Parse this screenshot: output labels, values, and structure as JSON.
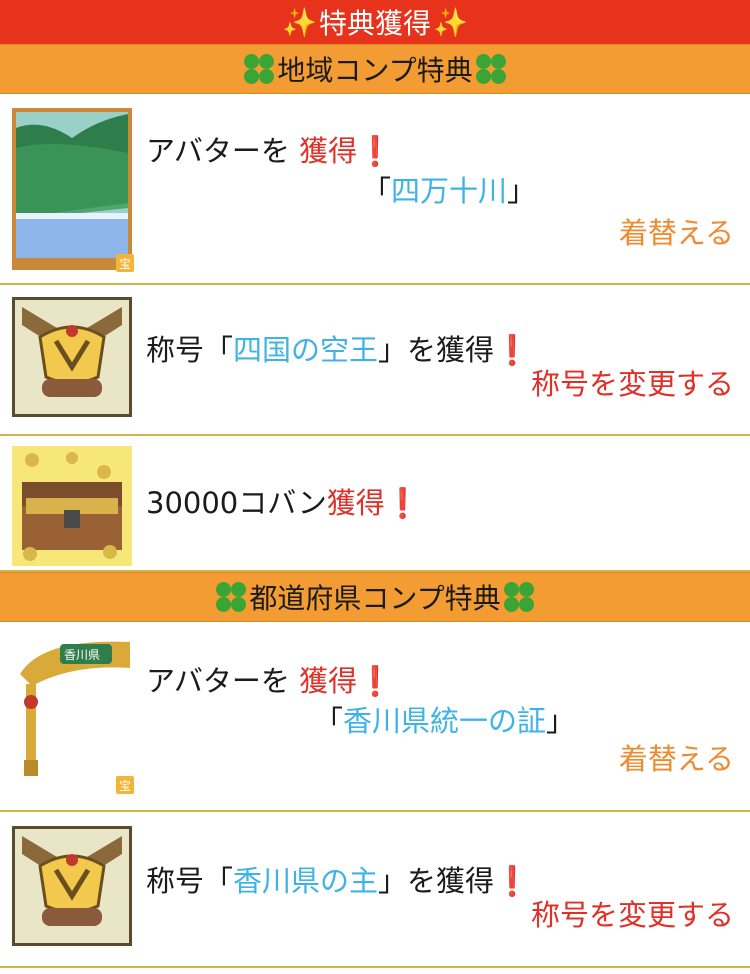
{
  "header": {
    "title": "特典獲得",
    "sparkle": "✨"
  },
  "sections": [
    {
      "title": "地域コンプ特典",
      "rows": [
        {
          "prefix": "アバターを",
          "highlight": "獲得",
          "excl": "❗",
          "quote_open": "「",
          "item_name": "四万十川",
          "quote_close": "」",
          "action": "着替える",
          "badge": "宝",
          "icon": "landscape-avatar-icon"
        },
        {
          "prefix": "称号「",
          "title_name": "四国の空王",
          "suffix": "」を獲得",
          "excl": "❗",
          "action": "称号を変更する",
          "icon": "kabuto-title-icon"
        },
        {
          "amount": "30000コバン",
          "highlight": "獲得",
          "excl": "❗",
          "icon": "treasure-chest-icon"
        }
      ]
    },
    {
      "title": "都道府県コンプ特典",
      "rows": [
        {
          "prefix": "アバターを",
          "highlight": "獲得",
          "excl": "❗",
          "quote_open": "「",
          "item_name": "香川県統一の証",
          "quote_close": "」",
          "action": "着替える",
          "badge": "宝",
          "icon": "winged-medal-avatar-icon",
          "medal_label": "香川県"
        },
        {
          "prefix": "称号「",
          "title_name": "香川県の主",
          "suffix": "」を獲得",
          "excl": "❗",
          "action": "称号を変更する",
          "icon": "kabuto-title-icon"
        }
      ]
    }
  ],
  "colors": {
    "top_bar": "#e8331c",
    "section_bar": "#f39c33",
    "divider": "#d6b24d",
    "link_blue": "#3fb3e6",
    "accent_red": "#e03027",
    "action_orange": "#ef8a2e"
  }
}
